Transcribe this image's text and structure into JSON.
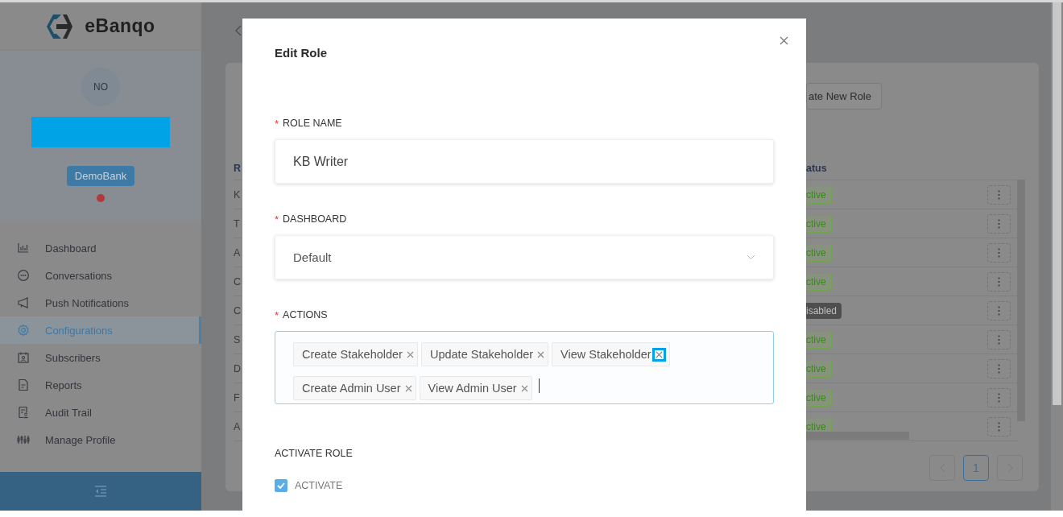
{
  "sidebar": {
    "logo_text": "eBanqo",
    "avatar_initials": "NO",
    "organization": "DemoBank",
    "items": [
      {
        "label": "Dashboard",
        "selected": false
      },
      {
        "label": "Conversations",
        "selected": false
      },
      {
        "label": "Push Notifications",
        "selected": false
      },
      {
        "label": "Configurations",
        "selected": true
      },
      {
        "label": "Subscribers",
        "selected": false
      },
      {
        "label": "Reports",
        "selected": false
      },
      {
        "label": "Audit Trail",
        "selected": false
      },
      {
        "label": "Manage Profile",
        "selected": false
      }
    ]
  },
  "background": {
    "create_button": "ate New Role",
    "table": {
      "columns": [
        "R",
        "atus"
      ],
      "rows": [
        {
          "column_1": "K",
          "status": "ctive",
          "kind": "active"
        },
        {
          "column_1": "T",
          "status": "ctive",
          "kind": "active"
        },
        {
          "column_1": "A",
          "status": "ctive",
          "kind": "active"
        },
        {
          "column_1": "C",
          "status": "ctive",
          "kind": "active"
        },
        {
          "column_1": "C",
          "status": "isabled",
          "kind": "disabled"
        },
        {
          "column_1": "S",
          "status": "ctive",
          "kind": "active"
        },
        {
          "column_1": "D",
          "status": "ctive",
          "kind": "active"
        },
        {
          "column_1": "F",
          "status": "ctive",
          "kind": "active"
        },
        {
          "column_1": "A",
          "status": "ctive",
          "kind": "active"
        }
      ]
    },
    "pagination": [
      {
        "label": "1",
        "selected": true
      }
    ]
  },
  "modal": {
    "title": "Edit Role",
    "role_name": {
      "label": "ROLE NAME",
      "required_mark": "*",
      "value": "KB Writer"
    },
    "dashboard": {
      "label": "DASHBOARD",
      "required_mark": "*",
      "value": "Default"
    },
    "actions": {
      "label": "ACTIONS",
      "required_mark": "*",
      "tags": [
        {
          "label": "Create Stakeholder",
          "highlighted": false
        },
        {
          "label": "Update Stakeholder",
          "highlighted": false
        },
        {
          "label": "View Stakeholder",
          "highlighted": true
        },
        {
          "label": "Create Admin User",
          "highlighted": false
        },
        {
          "label": "View Admin User",
          "highlighted": false
        }
      ]
    },
    "activate_section": "ACTIVATE ROLE",
    "activate": {
      "label": "ACTIVATE",
      "checked": true
    }
  }
}
